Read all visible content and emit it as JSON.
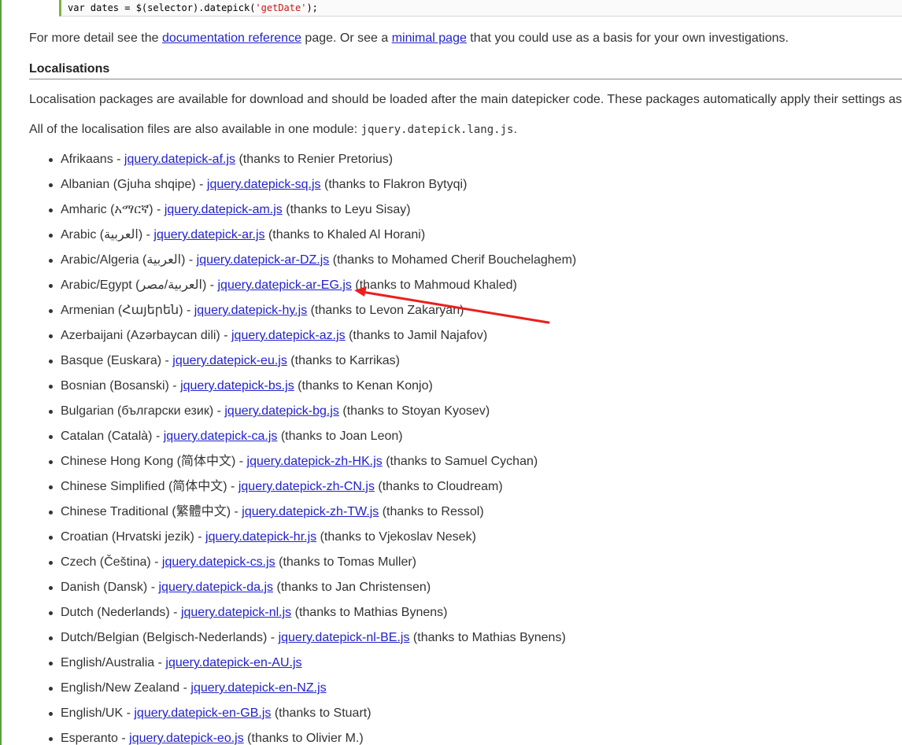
{
  "code_line": {
    "prefix": "var dates = $(selector).datepick(",
    "string": "'getDate'",
    "suffix": ");"
  },
  "detail": {
    "text_before": "For more detail see the ",
    "doc_link": "documentation reference",
    "text_middle": " page. Or see a ",
    "minimal_link": "minimal page",
    "text_after": " that you could use as a basis for your own investigations."
  },
  "localisations": {
    "heading": "Localisations",
    "intro": "Localisation packages are available for download and should be loaded after the main datepicker code. These packages automatically apply their settings as",
    "module_text_before": "All of the localisation files are also available in one module: ",
    "module_file": "jquery.datepick.lang.js",
    "module_text_after": "."
  },
  "languages": [
    {
      "name": "Afrikaans - ",
      "file": "jquery.datepick-af.js",
      "thanks": " (thanks to Renier Pretorius)"
    },
    {
      "name": "Albanian (Gjuha shqipe) - ",
      "file": "jquery.datepick-sq.js",
      "thanks": " (thanks to Flakron Bytyqi)"
    },
    {
      "name": "Amharic (አማርኛ) - ",
      "file": "jquery.datepick-am.js",
      "thanks": " (thanks to Leyu Sisay)"
    },
    {
      "name": "Arabic (العربية) - ",
      "file": "jquery.datepick-ar.js",
      "thanks": " (thanks to Khaled Al Horani)"
    },
    {
      "name": "Arabic/Algeria (العربية) - ",
      "file": "jquery.datepick-ar-DZ.js",
      "thanks": " (thanks to Mohamed Cherif Bouchelaghem)"
    },
    {
      "name": "Arabic/Egypt (العربية/مصر) - ",
      "file": "jquery.datepick-ar-EG.js",
      "thanks": " (thanks to Mahmoud Khaled)"
    },
    {
      "name": "Armenian (Հայերեն) - ",
      "file": "jquery.datepick-hy.js",
      "thanks": " (thanks to Levon Zakaryan)"
    },
    {
      "name": "Azerbaijani (Azərbaycan dili) - ",
      "file": "jquery.datepick-az.js",
      "thanks": " (thanks to Jamil Najafov)"
    },
    {
      "name": "Basque (Euskara) - ",
      "file": "jquery.datepick-eu.js",
      "thanks": " (thanks to Karrikas)"
    },
    {
      "name": "Bosnian (Bosanski) - ",
      "file": "jquery.datepick-bs.js",
      "thanks": " (thanks to Kenan Konjo)"
    },
    {
      "name": "Bulgarian (български език) - ",
      "file": "jquery.datepick-bg.js",
      "thanks": " (thanks to Stoyan Kyosev)"
    },
    {
      "name": "Catalan (Català) - ",
      "file": "jquery.datepick-ca.js",
      "thanks": " (thanks to Joan Leon)"
    },
    {
      "name": "Chinese Hong Kong (简体中文) - ",
      "file": "jquery.datepick-zh-HK.js",
      "thanks": " (thanks to Samuel Cychan)"
    },
    {
      "name": "Chinese Simplified (简体中文) - ",
      "file": "jquery.datepick-zh-CN.js",
      "thanks": " (thanks to Cloudream)"
    },
    {
      "name": "Chinese Traditional (繁體中文) - ",
      "file": "jquery.datepick-zh-TW.js",
      "thanks": " (thanks to Ressol)"
    },
    {
      "name": "Croatian (Hrvatski jezik) - ",
      "file": "jquery.datepick-hr.js",
      "thanks": " (thanks to Vjekoslav Nesek)"
    },
    {
      "name": "Czech (Čeština) - ",
      "file": "jquery.datepick-cs.js",
      "thanks": " (thanks to Tomas Muller)"
    },
    {
      "name": "Danish (Dansk) - ",
      "file": "jquery.datepick-da.js",
      "thanks": " (thanks to Jan Christensen)"
    },
    {
      "name": "Dutch (Nederlands) - ",
      "file": "jquery.datepick-nl.js",
      "thanks": " (thanks to Mathias Bynens)"
    },
    {
      "name": "Dutch/Belgian (Belgisch-Nederlands) - ",
      "file": "jquery.datepick-nl-BE.js",
      "thanks": " (thanks to Mathias Bynens)"
    },
    {
      "name": "English/Australia - ",
      "file": "jquery.datepick-en-AU.js",
      "thanks": ""
    },
    {
      "name": "English/New Zealand - ",
      "file": "jquery.datepick-en-NZ.js",
      "thanks": ""
    },
    {
      "name": "English/UK - ",
      "file": "jquery.datepick-en-GB.js",
      "thanks": " (thanks to Stuart)"
    },
    {
      "name": "Esperanto - ",
      "file": "jquery.datepick-eo.js",
      "thanks": " (thanks to Olivier M.)"
    }
  ],
  "colors": {
    "link": "#2222cc",
    "annotation_arrow": "#e8201e",
    "page_border": "#5aa03c"
  }
}
